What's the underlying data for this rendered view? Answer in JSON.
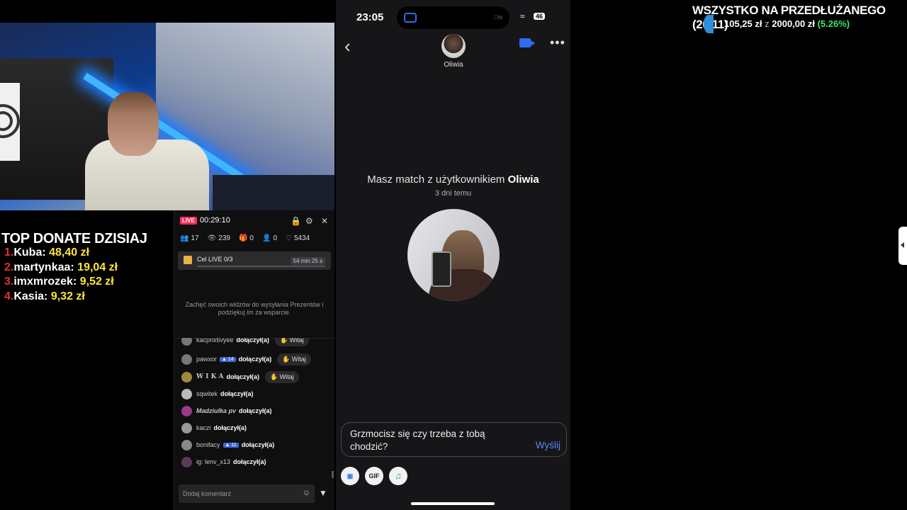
{
  "donations": {
    "title": "TOP DONATE DZISIAJ",
    "items": [
      {
        "num": "1.",
        "name": "Kuba:",
        "amount": "48,40 zł"
      },
      {
        "num": "2.",
        "name": "martynkaa:",
        "amount": "19,04 zł"
      },
      {
        "num": "3.",
        "name": "imxmrozek:",
        "amount": "9,52 zł"
      },
      {
        "num": "4.",
        "name": "Kasia:",
        "amount": "9,32 zł"
      }
    ]
  },
  "goal": {
    "title": "WSZYSTKO NA PRZEDŁUŻANEGO (20.11)",
    "current": "105,25 zł",
    "of": "z",
    "target": "2000,00 zł",
    "percent": "(5.26%)"
  },
  "live": {
    "badge": "LIVE",
    "time": "00:29:10",
    "stats": {
      "users": "17",
      "viewers": "239",
      "gifts": "0",
      "follows": "0",
      "likes": "5434"
    },
    "goal_label": "Cel LIVE",
    "goal_progress": "0/3",
    "goal_time": "54 min 25 s",
    "encourage": "Zachęć swoich widzów do wysyłania Prezentów i podziękuj im za wsparcie.",
    "witaj_label": "Witaj",
    "joined_label": "dołączył(a)",
    "chat": [
      {
        "name": "kacprix6vyee",
        "level": "",
        "witaj": true
      },
      {
        "name": "pawxor",
        "level": "14",
        "witaj": true
      },
      {
        "name": "W I K A",
        "level": "",
        "witaj": true
      },
      {
        "name": "sqwitek",
        "level": "",
        "witaj": false
      },
      {
        "name": "Madziulka pv",
        "level": "",
        "witaj": false
      },
      {
        "name": "kaczi",
        "level": "",
        "witaj": false
      },
      {
        "name": "bonifacy",
        "level": "11",
        "witaj": false
      },
      {
        "name": "ig: lenv_x13",
        "level": "",
        "witaj": false
      }
    ],
    "comment_placeholder": "Dodaj komentarz"
  },
  "phone": {
    "time": "23:05",
    "tv_label": "tv",
    "battery": "46",
    "contact_name": "Oliwia",
    "match_prefix": "Masz match z użytkownikiem",
    "match_name": "Oliwia",
    "match_ago": "3 dni temu",
    "message": "Grzmocisz się czy trzeba z tobą chodzić?",
    "send_label": "Wyślij",
    "gif_label": "GIF"
  },
  "colors": {
    "accent_blue": "#2f6cf0",
    "live_red": "#fe2c55",
    "donate_yellow": "#ffe53a",
    "goal_green": "#3ee86b"
  }
}
